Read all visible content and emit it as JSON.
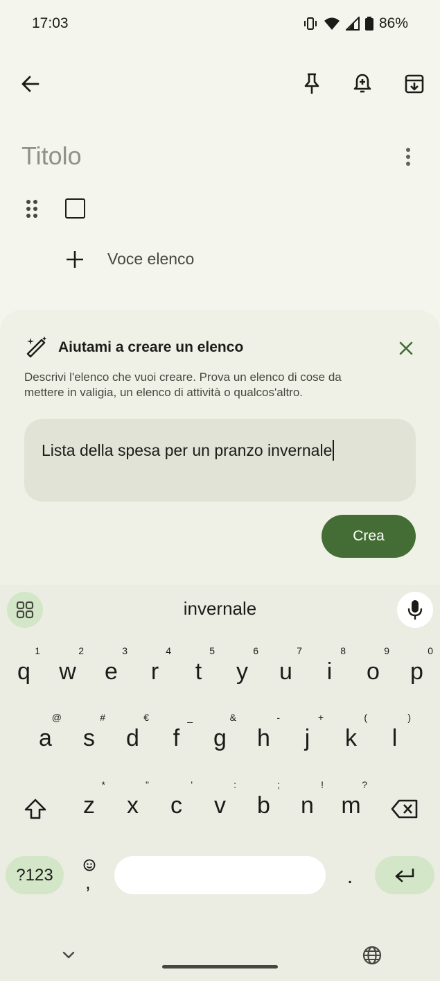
{
  "status_bar": {
    "time": "17:03",
    "battery": "86%",
    "icons": [
      "vibrate-icon",
      "wifi-icon",
      "signal-icon",
      "battery-icon"
    ]
  },
  "toolbar": {
    "back_icon": "arrow-left-icon",
    "actions": [
      "pin-icon",
      "reminder-bell-icon",
      "archive-icon"
    ]
  },
  "note": {
    "title_placeholder": "Titolo",
    "more_icon": "more-vertical-icon",
    "add_item_label": "Voce elenco"
  },
  "ai_panel": {
    "title": "Aiutami a creare un elenco",
    "description": "Descrivi l'elenco che vuoi creare. Prova un elenco di cose da mettere in valigia, un elenco di attività o qualcos'altro.",
    "prompt_value": "Lista della spesa per un pranzo invernale",
    "create_label": "Crea",
    "accent": "#446d35"
  },
  "keyboard": {
    "suggestion": "invernale",
    "row1": [
      {
        "k": "q",
        "h": "1"
      },
      {
        "k": "w",
        "h": "2"
      },
      {
        "k": "e",
        "h": "3"
      },
      {
        "k": "r",
        "h": "4"
      },
      {
        "k": "t",
        "h": "5"
      },
      {
        "k": "y",
        "h": "6"
      },
      {
        "k": "u",
        "h": "7"
      },
      {
        "k": "i",
        "h": "8"
      },
      {
        "k": "o",
        "h": "9"
      },
      {
        "k": "p",
        "h": "0"
      }
    ],
    "row2": [
      {
        "k": "a",
        "h": "@"
      },
      {
        "k": "s",
        "h": "#"
      },
      {
        "k": "d",
        "h": "€"
      },
      {
        "k": "f",
        "h": "_"
      },
      {
        "k": "g",
        "h": "&"
      },
      {
        "k": "h",
        "h": "-"
      },
      {
        "k": "j",
        "h": "+"
      },
      {
        "k": "k",
        "h": "("
      },
      {
        "k": "l",
        "h": ")"
      }
    ],
    "row3": [
      {
        "k": "z",
        "h": "*"
      },
      {
        "k": "x",
        "h": "\""
      },
      {
        "k": "c",
        "h": "'"
      },
      {
        "k": "v",
        "h": ":"
      },
      {
        "k": "b",
        "h": ";"
      },
      {
        "k": "n",
        "h": "!"
      },
      {
        "k": "m",
        "h": "?"
      }
    ],
    "symbols_label": "?123",
    "emoji_sub": ",",
    "period": "."
  }
}
